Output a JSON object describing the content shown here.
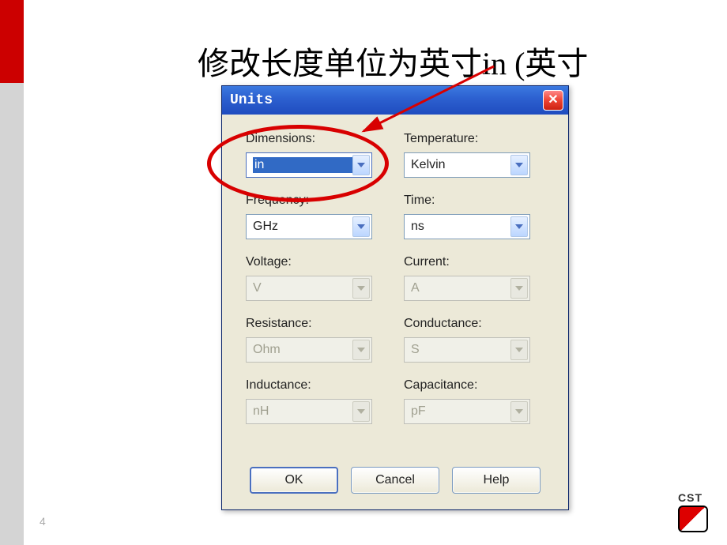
{
  "slide": {
    "title": "修改长度单位为英寸in (英寸",
    "page_number": "4",
    "logo_text": "CST"
  },
  "dialog": {
    "title": "Units",
    "fields": {
      "dimensions": {
        "label": "Dimensions:",
        "value": "in"
      },
      "temperature": {
        "label": "Temperature:",
        "value": "Kelvin"
      },
      "frequency": {
        "label": "Frequency:",
        "value": "GHz"
      },
      "time": {
        "label": "Time:",
        "value": "ns"
      },
      "voltage": {
        "label": "Voltage:",
        "value": "V"
      },
      "current": {
        "label": "Current:",
        "value": "A"
      },
      "resistance": {
        "label": "Resistance:",
        "value": "Ohm"
      },
      "conductance": {
        "label": "Conductance:",
        "value": "S"
      },
      "inductance": {
        "label": "Inductance:",
        "value": "nH"
      },
      "capacitance": {
        "label": "Capacitance:",
        "value": "pF"
      }
    },
    "buttons": {
      "ok": "OK",
      "cancel": "Cancel",
      "help": "Help"
    }
  }
}
